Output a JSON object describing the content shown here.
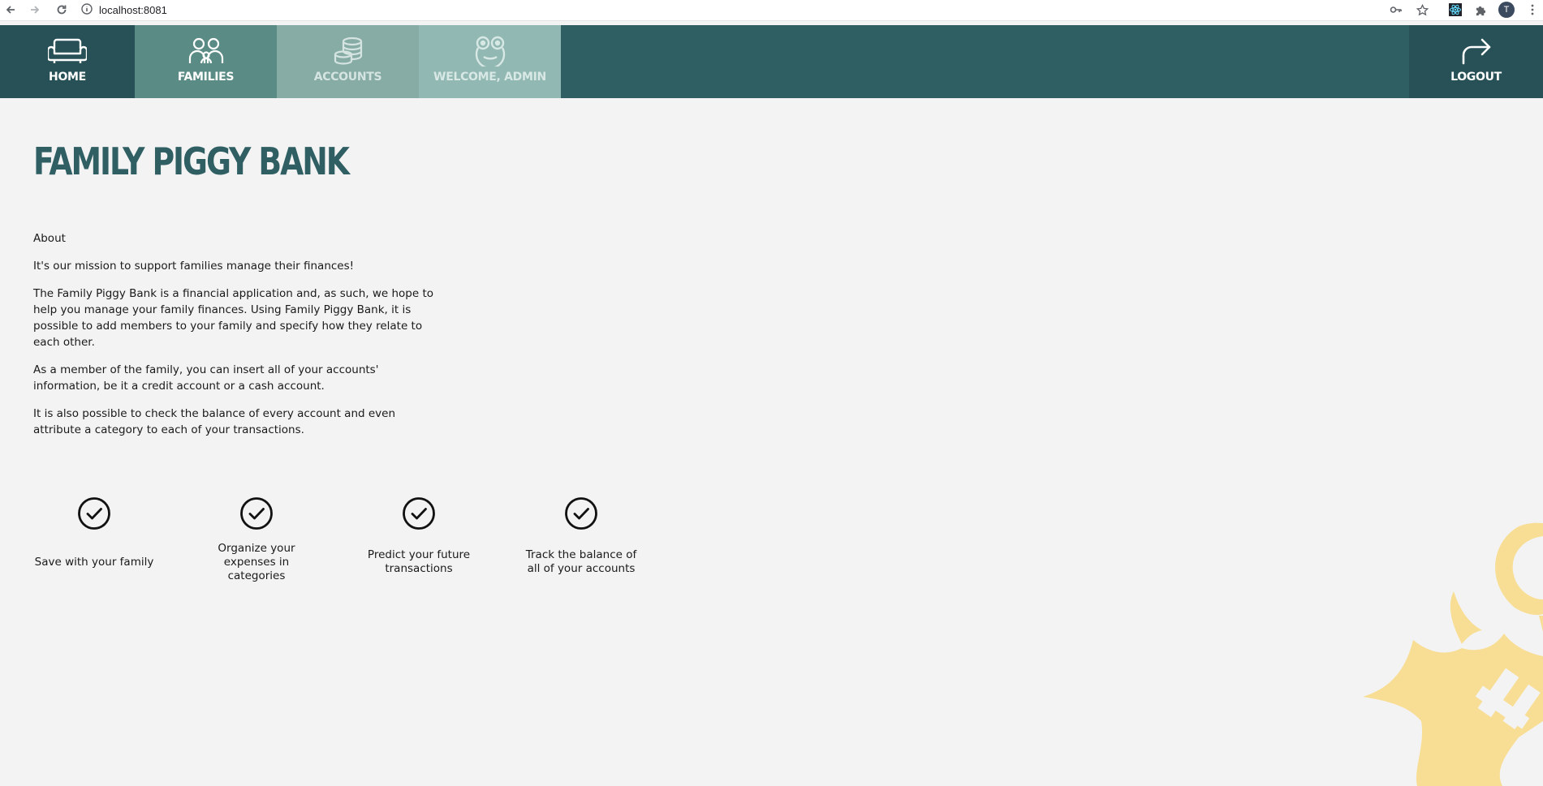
{
  "browser": {
    "url": "localhost:8081",
    "avatar_letter": "T",
    "icons": [
      "back-arrow-icon",
      "forward-arrow-icon",
      "reload-icon",
      "info-icon",
      "key-icon",
      "star-icon",
      "react-extension-icon",
      "puzzle-icon",
      "kebab-menu-icon"
    ]
  },
  "nav": {
    "home": "HOME",
    "families": "FAMILIES",
    "accounts": "ACCOUNTS",
    "welcome": "WELCOME, ADMIN",
    "logout": "LOGOUT"
  },
  "colors": {
    "nav_background": "#2f5e63",
    "nav_home": "#275157",
    "nav_families": "#5a8b85",
    "nav_accounts": "#87aca5",
    "nav_welcome": "#92b8b3",
    "title": "#2f5e63",
    "decoration": "#f8de94"
  },
  "main": {
    "title": "FAMILY PIGGY BANK",
    "about_heading": "About",
    "paragraphs": [
      "It's our mission to support families manage their finances!",
      "The Family Piggy Bank is a financial application and, as such, we hope to help you manage your family finances. Using Family Piggy Bank, it is possible to add members to your family and specify how they relate to each other.",
      "As a member of the family, you can insert all of your accounts' information, be it a credit account or a cash account.",
      "It is also possible to check the balance of every account and even attribute a category to each of your transactions."
    ],
    "features": [
      "Save with your family",
      "Organize your expenses in categories",
      "Predict your future transactions",
      "Track the balance of all of your accounts"
    ]
  }
}
